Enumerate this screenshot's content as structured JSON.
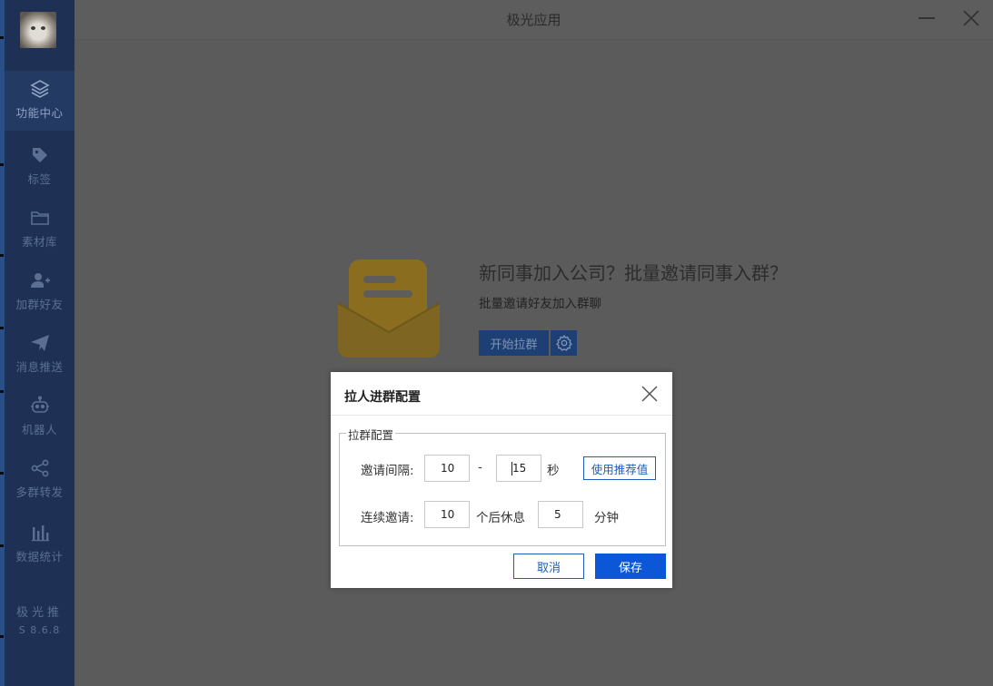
{
  "window": {
    "title": "极光应用"
  },
  "sidebar": {
    "items": [
      {
        "label": "功能中心",
        "icon": "layers-icon",
        "active": true
      },
      {
        "label": "标签",
        "icon": "tag-icon",
        "active": false
      },
      {
        "label": "素材库",
        "icon": "folder-icon",
        "active": false
      },
      {
        "label": "加群好友",
        "icon": "add-user-icon",
        "active": false
      },
      {
        "label": "消息推送",
        "icon": "paper-plane-icon",
        "active": false
      },
      {
        "label": "机器人",
        "icon": "robot-icon",
        "active": false
      },
      {
        "label": "多群转发",
        "icon": "share-icon",
        "active": false
      },
      {
        "label": "数据统计",
        "icon": "bar-chart-icon",
        "active": false
      }
    ],
    "brand": {
      "name": "极光推",
      "version": "S 8.6.8"
    }
  },
  "main": {
    "headline": "新同事加入公司？批量邀请同事入群？",
    "subline": "批量邀请好友加入群聊",
    "start_button": "开始拉群"
  },
  "dialog": {
    "title": "拉人进群配置",
    "group_title": "拉群配置",
    "interval": {
      "label": "邀请间隔:",
      "min": "10",
      "separator": "-",
      "max": "15",
      "unit": "秒",
      "recommend_button": "使用推荐值"
    },
    "continuous": {
      "label": "连续邀请:",
      "count": "10",
      "after_text": "个后休息",
      "rest": "5",
      "unit": "分钟"
    },
    "cancel_button": "取消",
    "save_button": "保存"
  },
  "colors": {
    "sidebar_bg": "#1e3155",
    "overlay_bg": "#5b5b5b",
    "primary": "#0b57d8",
    "envelope": "#8a6d1f"
  }
}
